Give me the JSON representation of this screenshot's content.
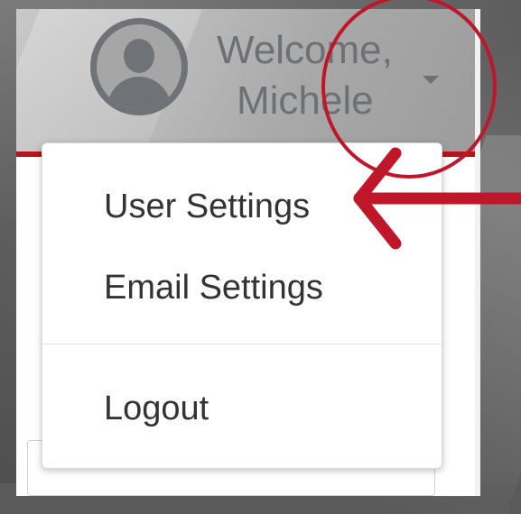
{
  "header": {
    "welcome_line": "Welcome,",
    "user_name": "Michele"
  },
  "dropdown": {
    "items": [
      {
        "label": "User Settings"
      },
      {
        "label": "Email Settings"
      },
      {
        "label": "Logout"
      }
    ]
  },
  "colors": {
    "accent_red": "#b7141d",
    "annotation_red": "#c0162a",
    "header_text": "#6d7074"
  },
  "icons": {
    "avatar": "user-avatar-icon",
    "caret": "caret-down-icon",
    "arrow": "arrow-left-annotation",
    "circle": "circle-annotation"
  }
}
